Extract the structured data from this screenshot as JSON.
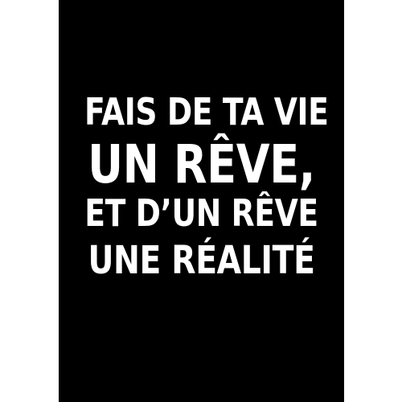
{
  "poster": {
    "background_color": "#000000",
    "text_color": "#ffffff",
    "lines": [
      "FAIS DE TA VIE",
      "UN RÊVE,",
      "ET D’UN RÊVE",
      "UNE RÉALITÉ"
    ]
  }
}
